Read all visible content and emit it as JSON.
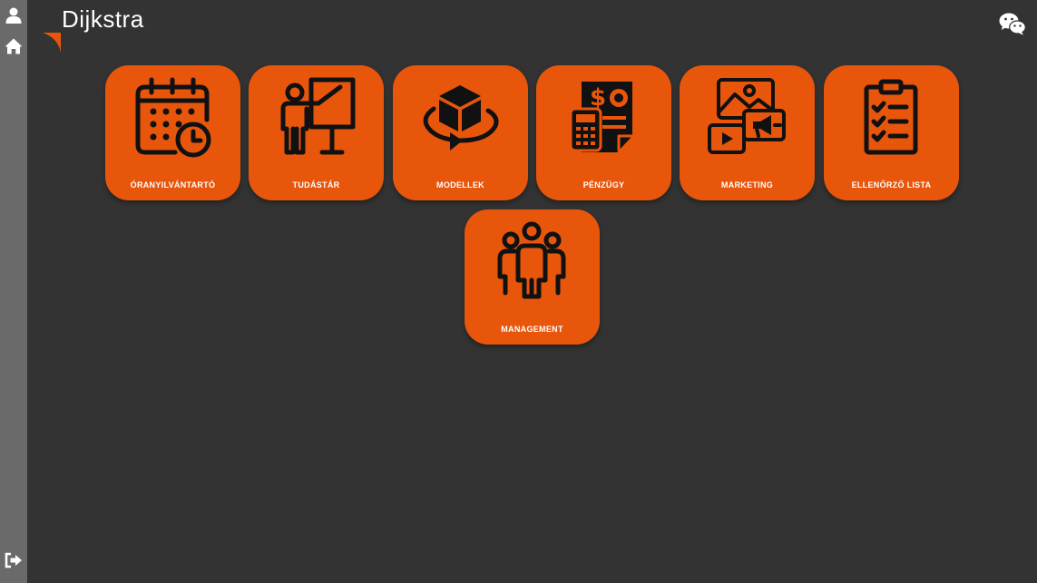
{
  "app": {
    "title": "Dijkstra"
  },
  "sidebar": {
    "icons": [
      {
        "name": "user-icon"
      },
      {
        "name": "home-icon"
      },
      {
        "name": "logout-icon"
      }
    ]
  },
  "header": {
    "right_icon": "wechat-icon"
  },
  "tiles": [
    {
      "label": "ÓRANYILVÁNTARTÓ",
      "icon": "calendar-clock-icon"
    },
    {
      "label": "TUDÁSTÁR",
      "icon": "presentation-teacher-icon"
    },
    {
      "label": "MODELLEK",
      "icon": "cube-rotate-icon"
    },
    {
      "label": "PÉNZÜGY",
      "icon": "finance-calculator-icon"
    },
    {
      "label": "MARKETING",
      "icon": "marketing-media-icon"
    },
    {
      "label": "ELLENŐRZŐ LISTA",
      "icon": "checklist-clipboard-icon"
    },
    {
      "label": "MANAGEMENT",
      "icon": "team-group-icon"
    }
  ],
  "colors": {
    "accent": "#e8560b",
    "background": "#333333",
    "sidebar": "#6a6a6a",
    "text": "#ffffff",
    "icon": "#111111"
  }
}
